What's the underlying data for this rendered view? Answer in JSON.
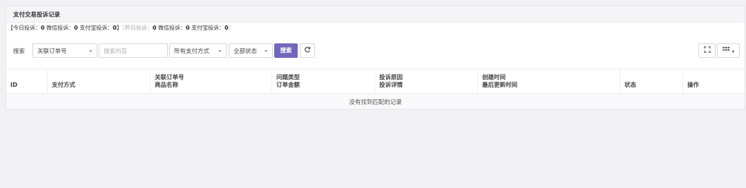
{
  "panel": {
    "title": "支付交易投诉记录",
    "stats_open": "【今日投诉：",
    "today_total": "0",
    "wechat_label": " 微信投诉：",
    "today_wechat": "0",
    "alipay_label": " 支付宝投诉：",
    "today_alipay": "0",
    "stats_mid": "】",
    "yesterday_open": "〖昨日投诉：",
    "yesterday_total": "0",
    "y_wechat_label": " 微信投诉：",
    "yesterday_wechat": "0",
    "y_alipay_label": " 支付宝投诉：",
    "yesterday_alipay": "0",
    "stats_close": "〗"
  },
  "toolbar": {
    "search_label": "搜索",
    "field_select": "关联订单号",
    "search_placeholder": "搜索内容",
    "paytype_select": "所有支付方式",
    "status_select": "全部状态",
    "search_button": "搜索"
  },
  "table": {
    "columns": [
      {
        "l1": "ID",
        "l2": ""
      },
      {
        "l1": "支付方式",
        "l2": ""
      },
      {
        "l1": "关联订单号",
        "l2": "商品名称"
      },
      {
        "l1": "问题类型",
        "l2": "订单金额"
      },
      {
        "l1": "投诉原因",
        "l2": "投诉详情"
      },
      {
        "l1": "创建时间",
        "l2": "最后更新时间"
      },
      {
        "l1": "状态",
        "l2": ""
      },
      {
        "l1": "操作",
        "l2": ""
      }
    ],
    "empty_text": "没有找到匹配的记录"
  },
  "icons": {
    "refresh": "refresh-icon",
    "fullscreen": "fullscreen-icon",
    "columns": "columns-grid-icon"
  },
  "colors": {
    "primary": "#7266ba"
  }
}
